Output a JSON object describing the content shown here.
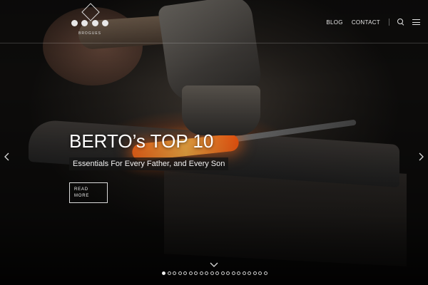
{
  "brand": {
    "name": "BROGUES"
  },
  "nav": {
    "blog_label": "BLOG",
    "contact_label": "CONTACT",
    "search_icon": "search-icon",
    "menu_icon": "hamburger-menu-icon"
  },
  "slide": {
    "title": "BERTO’s TOP 10",
    "subtitle": "Essentials For Every Father, and Every Son",
    "cta_line1": "READ",
    "cta_line2": "MORE"
  },
  "carousel": {
    "prev_icon": "chevron-left-icon",
    "next_icon": "chevron-right-icon",
    "scroll_icon": "chevron-down-icon",
    "total_slides": 20,
    "active_index": 0
  }
}
